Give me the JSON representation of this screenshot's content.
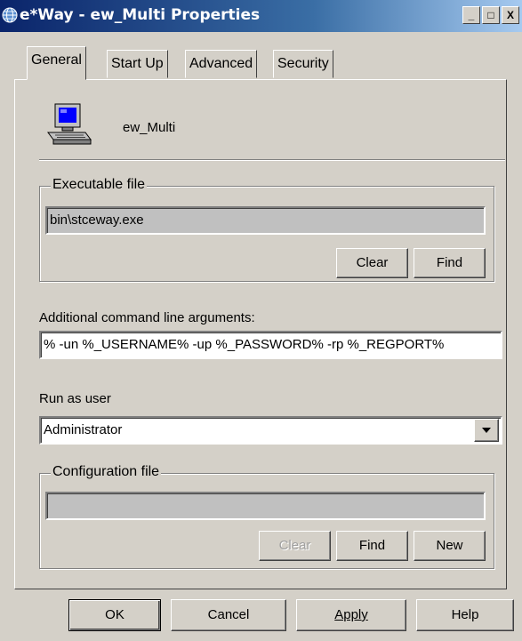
{
  "window": {
    "title": "e*Way - ew_Multi Properties",
    "controls": {
      "minimize": "_",
      "maximize": "□",
      "close": "X"
    }
  },
  "tabs": [
    {
      "label": "General",
      "selected": true
    },
    {
      "label": "Start Up",
      "selected": false
    },
    {
      "label": "Advanced",
      "selected": false
    },
    {
      "label": "Security",
      "selected": false
    }
  ],
  "general": {
    "component_icon": "computer-icon",
    "component_name": "ew_Multi",
    "executable": {
      "group_label": "Executable file",
      "value": "bin\\stceway.exe",
      "clear_label": "Clear",
      "find_label": "Find"
    },
    "args": {
      "label": "Additional command line arguments:",
      "value": "%  -un %_USERNAME% -up %_PASSWORD% -rp %_REGPORT%"
    },
    "run_as": {
      "label": "Run as user",
      "selected": "Administrator"
    },
    "config": {
      "group_label": "Configuration file",
      "value": "",
      "clear_label": "Clear",
      "find_label": "Find",
      "new_label": "New"
    }
  },
  "footer": {
    "ok_label": "OK",
    "cancel_label": "Cancel",
    "apply_label": "Apply",
    "help_label": "Help"
  },
  "colors": {
    "titlebar_start": "#0a246a",
    "titlebar_end": "#a6caf0",
    "dialog_face": "#d4d0c8"
  }
}
